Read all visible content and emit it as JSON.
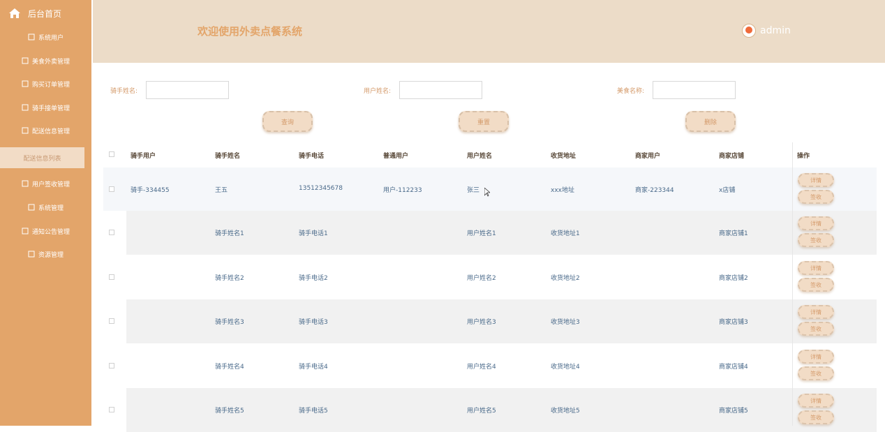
{
  "sidebar": {
    "brand": "后台首页",
    "items": [
      {
        "label": "系统用户"
      },
      {
        "label": "美食外卖管理"
      },
      {
        "label": "购买订单管理"
      },
      {
        "label": "骑手接单管理"
      },
      {
        "label": "配送信息管理"
      },
      {
        "label": "配送信息列表",
        "active": true
      },
      {
        "label": "用户签收管理"
      },
      {
        "label": "系统管理"
      },
      {
        "label": "通知公告管理"
      },
      {
        "label": "资源管理"
      }
    ]
  },
  "header": {
    "title": "欢迎使用外卖点餐系统",
    "user": "admin"
  },
  "search": {
    "rider_name_label": "骑手姓名:",
    "user_name_label": "用户姓名:",
    "food_name_label": "美食名称:"
  },
  "buttons": {
    "query": "查询",
    "reset": "重置",
    "delete": "删除"
  },
  "table": {
    "headers": [
      "骑手用户",
      "骑手姓名",
      "骑手电话",
      "普通用户",
      "用户姓名",
      "收货地址",
      "商家用户",
      "商家店铺",
      "操作"
    ],
    "rows": [
      [
        "骑手-334455",
        "王五",
        "13512345678",
        "用户-112233",
        "张三",
        "xxx地址",
        "商家-223344",
        "x店铺"
      ],
      [
        "",
        "骑手姓名1",
        "骑手电话1",
        "",
        "用户姓名1",
        "收货地址1",
        "",
        "商家店铺1"
      ],
      [
        "",
        "骑手姓名2",
        "骑手电话2",
        "",
        "用户姓名2",
        "收货地址2",
        "",
        "商家店铺2"
      ],
      [
        "",
        "骑手姓名3",
        "骑手电话3",
        "",
        "用户姓名3",
        "收货地址3",
        "",
        "商家店铺3"
      ],
      [
        "",
        "骑手姓名4",
        "骑手电话4",
        "",
        "用户姓名4",
        "收货地址4",
        "",
        "商家店铺4"
      ],
      [
        "",
        "骑手姓名5",
        "骑手电话5",
        "",
        "用户姓名5",
        "收货地址5",
        "",
        "商家店铺5"
      ]
    ],
    "op_detail": "详情",
    "op_sign": "签收"
  }
}
